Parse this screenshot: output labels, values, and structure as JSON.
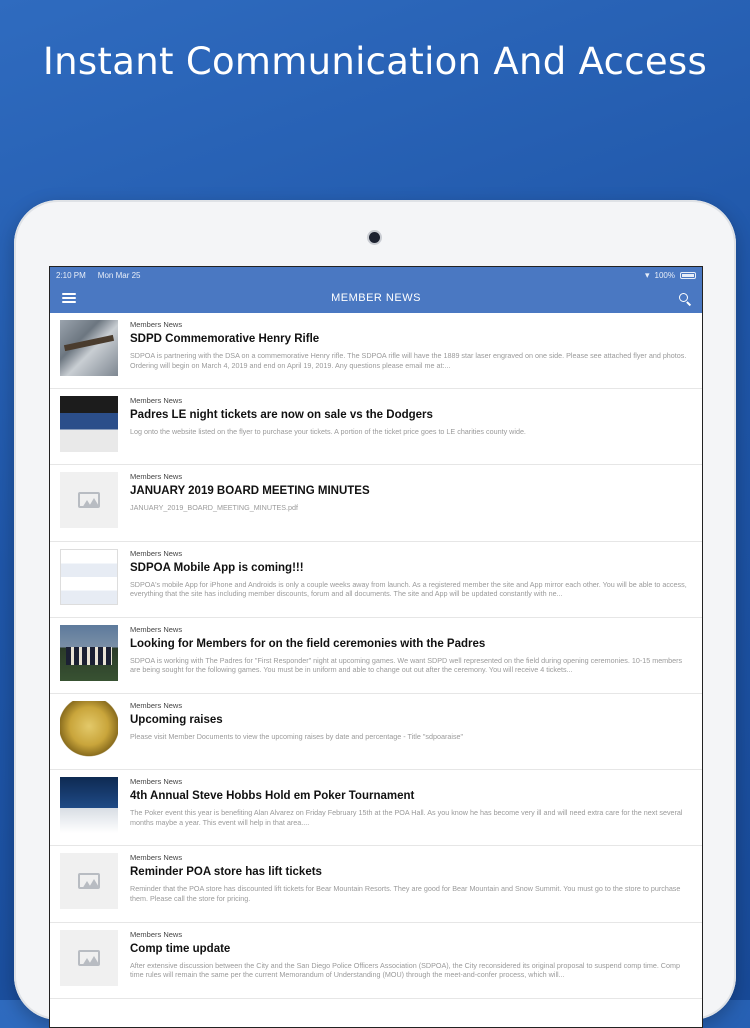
{
  "headline": "Instant Communication And Access",
  "status_bar": {
    "time": "2:10 PM",
    "date": "Mon Mar 25",
    "battery": "100%"
  },
  "navbar": {
    "title": "MEMBER NEWS",
    "menu_icon": "hamburger-icon",
    "search_icon": "search-icon"
  },
  "news": [
    {
      "category": "Members News",
      "title": "SDPD Commemorative Henry Rifle",
      "excerpt": "SDPOA is partnering with the DSA on a commemorative Henry rifle. The SDPOA rifle will have the 1889 star laser engraved on one side. Please see attached flyer and photos. Ordering will begin on March 4, 2019 and end on April 19, 2019.  Any questions please email me at:...",
      "thumb": "photo-rifle"
    },
    {
      "category": "Members News",
      "title": "Padres LE night tickets are now on sale vs the Dodgers",
      "excerpt": "Log onto the website listed on the flyer to purchase your tickets.  A portion of the ticket price goes to LE charities county wide.",
      "thumb": "photo-dodgers"
    },
    {
      "category": "Members News",
      "title": "JANUARY 2019 BOARD MEETING MINUTES",
      "excerpt": "JANUARY_2019_BOARD_MEETING_MINUTES.pdf",
      "thumb": "placeholder"
    },
    {
      "category": "Members News",
      "title": "SDPOA Mobile App is coming!!!",
      "excerpt": "SDPOA's mobile App for iPhone and Androids is only a couple weeks away from launch. As a registered member the site and App mirror each other. You will be able to access, everything that the site has including member discounts, forum and all documents. The site and App will be updated constantly with ne...",
      "thumb": "photo-app"
    },
    {
      "category": "Members News",
      "title": "Looking for Members for on the field ceremonies with the Padres",
      "excerpt": "SDPOA is working with The Padres for \"First Responder\" night at upcoming games. We want SDPD well represented on the field during opening ceremonies. 10-15 members are being sought for the following games. You must be in uniform and able to change out out after the ceremony. You will receive 4 tickets...",
      "thumb": "photo-field"
    },
    {
      "category": "Members News",
      "title": "Upcoming raises",
      "excerpt": "Please visit Member Documents to view the upcoming raises by date and percentage - Title \"sdpoaraise\"",
      "thumb": "photo-badge"
    },
    {
      "category": "Members News",
      "title": "4th Annual Steve Hobbs Hold em Poker Tournament",
      "excerpt": "The Poker event this year is benefiting Alan Alvarez on Friday February 15th at the POA Hall. As you know he has become very ill and will need extra care for the next several months maybe a year. This event will help in that area....",
      "thumb": "photo-poker"
    },
    {
      "category": "Members News",
      "title": "Reminder POA store has lift tickets",
      "excerpt": "Reminder that the POA store has discounted lift tickets for Bear Mountain Resorts.  They are good for Bear Mountain and Snow Summit.  You must go to the store to purchase them.  Please call the store for pricing.",
      "thumb": "placeholder"
    },
    {
      "category": "Members News",
      "title": "Comp time update",
      "excerpt": "After extensive discussion between the City and the San Diego Police Officers Association (SDPOA), the City reconsidered its original proposal to suspend comp time. Comp time rules will remain the same per the current Memorandum of Understanding (MOU) through the meet-and-confer process, which will...",
      "thumb": "placeholder"
    }
  ]
}
